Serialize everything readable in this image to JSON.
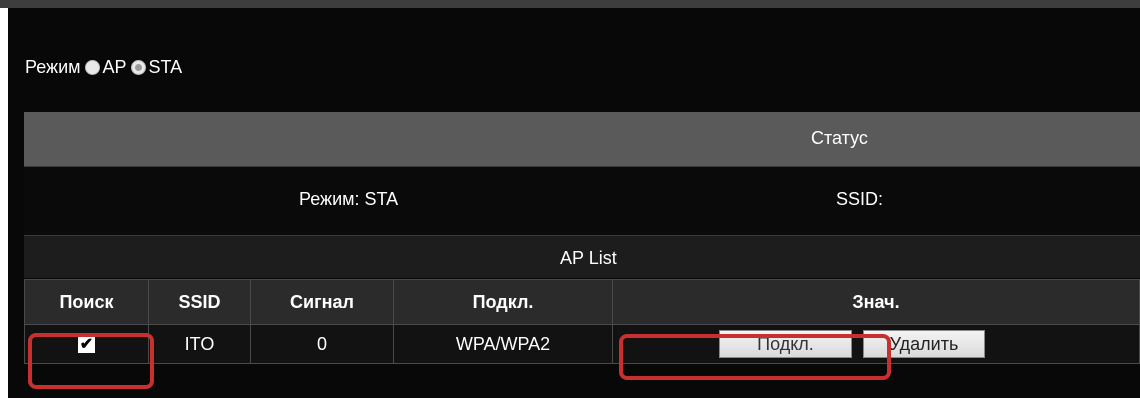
{
  "mode": {
    "label": "Режим",
    "options": [
      {
        "label": "AP",
        "selected": false
      },
      {
        "label": "STA",
        "selected": true
      }
    ]
  },
  "status": {
    "header": "Статус",
    "mode_text": "Режим: STA",
    "ssid_text": "SSID:"
  },
  "ap_list": {
    "header": "AP List",
    "columns": [
      "Поиск",
      "SSID",
      "Сигнал",
      "Подкл.",
      "Знач."
    ],
    "rows": [
      {
        "checked": true,
        "check_glyph": "✔",
        "ssid": "ITO",
        "signal": "0",
        "security": "WPA/WPA2",
        "connect_label": "Подкл.",
        "delete_label": "Удалить"
      }
    ]
  },
  "colors": {
    "panel": "#080808",
    "status_header": "#5a5a5a",
    "highlight": "#c8302f"
  }
}
